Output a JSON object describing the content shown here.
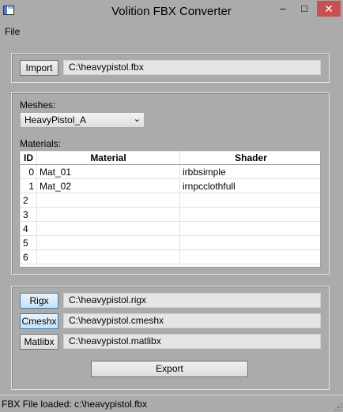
{
  "window": {
    "title": "Volition FBX Converter",
    "min_glyph": "–",
    "max_glyph": "□",
    "close_glyph": "✕"
  },
  "menu": {
    "file": "File"
  },
  "import": {
    "button": "Import",
    "path": "C:\\heavypistol.fbx"
  },
  "meshes": {
    "label": "Meshes:",
    "selected": "HeavyPistol_A",
    "arrow": "⌄"
  },
  "materials": {
    "label": "Materials:",
    "columns": [
      "ID",
      "Material",
      "Shader"
    ],
    "rows": [
      {
        "id": "0",
        "material": "Mat_01",
        "shader": "irbbsimple"
      },
      {
        "id": "1",
        "material": "Mat_02",
        "shader": "irnpcclothfull"
      },
      {
        "id": "2",
        "material": "",
        "shader": ""
      },
      {
        "id": "3",
        "material": "",
        "shader": ""
      },
      {
        "id": "4",
        "material": "",
        "shader": ""
      },
      {
        "id": "5",
        "material": "",
        "shader": ""
      },
      {
        "id": "6",
        "material": "",
        "shader": ""
      }
    ]
  },
  "outputs": {
    "rigx_button": "Rigx",
    "rigx_path": "C:\\heavypistol.rigx",
    "cmeshx_button": "Cmeshx",
    "cmeshx_path": "C:\\heavypistol.cmeshx",
    "matlibx_button": "Matlibx",
    "matlibx_path": "C:\\heavypistol.matlibx",
    "export_button": "Export"
  },
  "status": {
    "text": "FBX File loaded: c:\\heavypistol.fbx"
  },
  "colors": {
    "background": "#ababab",
    "close_button": "#c75050",
    "focused_button": "#c6e2f9"
  }
}
